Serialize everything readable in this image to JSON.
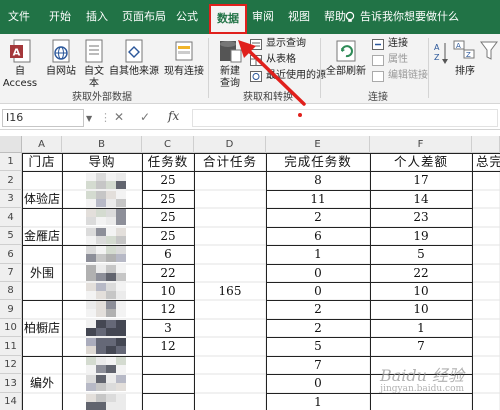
{
  "menu": {
    "tabs": [
      {
        "label": "文件"
      },
      {
        "label": "开始"
      },
      {
        "label": "插入"
      },
      {
        "label": "页面布局"
      },
      {
        "label": "公式"
      },
      {
        "label": "数据"
      },
      {
        "label": "审阅"
      },
      {
        "label": "视图"
      },
      {
        "label": "帮助"
      }
    ],
    "active_tab": "数据",
    "tell_me": "告诉我你想要做什么"
  },
  "ribbon": {
    "get_external": {
      "access": "自 Access",
      "web": "自网站",
      "text": "自文本",
      "other": "自其他来源",
      "existing": "现有连接",
      "label": "获取外部数据"
    },
    "get_transform": {
      "new_query_line1": "新建",
      "new_query_line2": "查询",
      "show_queries": "显示查询",
      "from_table": "从表格",
      "recent_sources": "最近使用的源",
      "label": "获取和转换"
    },
    "connections": {
      "refresh_all": "全部刷新",
      "connections": "连接",
      "properties": "属性",
      "edit_links": "编辑链接",
      "label": "连接"
    },
    "sort": {
      "sort": "排序"
    }
  },
  "formula_bar": {
    "name_box": "I16",
    "formula": ""
  },
  "sheet": {
    "columns": [
      "A",
      "B",
      "C",
      "D",
      "E",
      "F"
    ],
    "rows": [
      "1",
      "2",
      "3",
      "4",
      "5",
      "6",
      "7",
      "8",
      "9",
      "10",
      "11",
      "12",
      "13",
      "14"
    ],
    "headers": {
      "a": "门店",
      "b": "导购",
      "c": "任务数",
      "d": "合计任务",
      "e": "完成任务数",
      "f": "个人差额",
      "g": "总完"
    },
    "stores": [
      "体验店",
      "金雁店",
      "外围",
      "柏橱店",
      "编外"
    ],
    "tasks": [
      "25",
      "25",
      "25",
      "25",
      "6",
      "22",
      "10",
      "12",
      "3",
      "12"
    ],
    "total": "165",
    "completed": [
      "8",
      "11",
      "2",
      "6",
      "1",
      "0",
      "0",
      "2",
      "2",
      "5",
      "7",
      "0",
      "1"
    ],
    "diff": [
      "17",
      "14",
      "23",
      "19",
      "5",
      "22",
      "10",
      "10",
      "1",
      "7"
    ]
  },
  "watermark": {
    "main": "Baidu 经验",
    "sub": "jingyan.baidu.com"
  },
  "colors": {
    "excel_green": "#217346",
    "highlight_red": "#e0201c"
  }
}
